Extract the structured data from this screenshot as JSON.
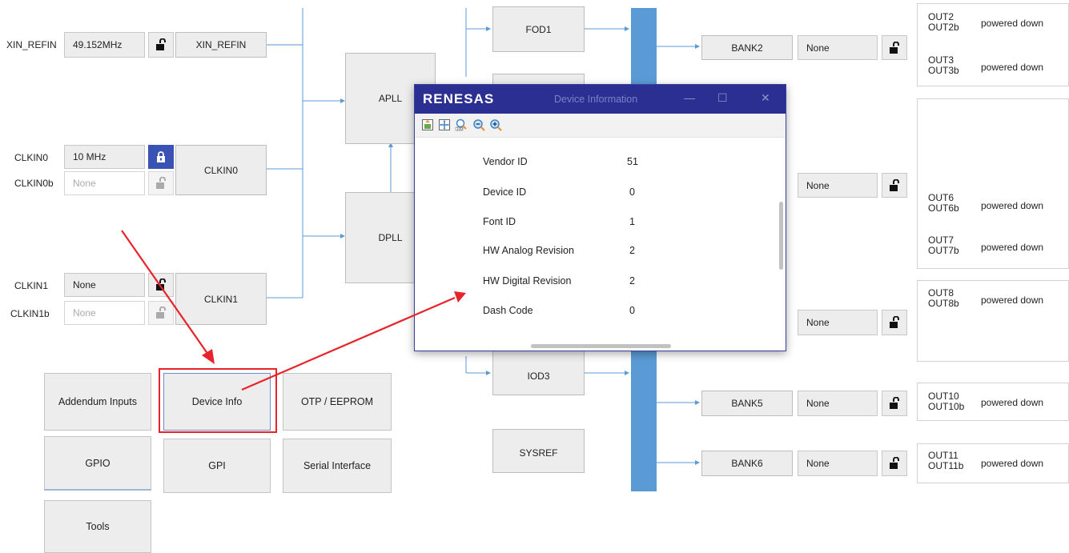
{
  "inputs": {
    "xin": {
      "label": "XIN_REFIN",
      "value": "49.152MHz",
      "block": "XIN_REFIN"
    },
    "clkin0": {
      "label": "CLKIN0",
      "value": "10 MHz",
      "block": "CLKIN0"
    },
    "clkin0b": {
      "label": "CLKIN0b",
      "value": "None"
    },
    "clkin1": {
      "label": "CLKIN1",
      "value": "None",
      "block": "CLKIN1"
    },
    "clkin1b": {
      "label": "CLKIN1b",
      "value": "None"
    }
  },
  "plls": {
    "apll": "APLL",
    "dpll": "DPLL"
  },
  "dividers": {
    "fod1": "FOD1",
    "iod3": "IOD3",
    "sysref": "SYSREF"
  },
  "banks": [
    {
      "name": "BANK2",
      "value": "None"
    },
    {
      "name": "",
      "value": "None"
    },
    {
      "name": "",
      "value": "None"
    },
    {
      "name": "BANK5",
      "value": "None"
    },
    {
      "name": "BANK6",
      "value": "None"
    }
  ],
  "outputs": [
    {
      "a": "OUT2",
      "b": "OUT2b",
      "status": "powered down"
    },
    {
      "a": "OUT3",
      "b": "OUT3b",
      "status": "powered down"
    },
    {
      "a": "OUT6",
      "b": "OUT6b",
      "status": "powered down"
    },
    {
      "a": "OUT7",
      "b": "OUT7b",
      "status": "powered down"
    },
    {
      "a": "OUT8",
      "b": "OUT8b",
      "status": "powered down"
    },
    {
      "a": "OUT10",
      "b": "OUT10b",
      "status": "powered down"
    },
    {
      "a": "OUT11",
      "b": "OUT11b",
      "status": "powered down"
    }
  ],
  "buttons": {
    "addendum": "Addendum Inputs",
    "device_info": "Device Info",
    "otp": "OTP / EEPROM",
    "gpio": "GPIO",
    "gpi": "GPI",
    "serial": "Serial Interface",
    "tools": "Tools"
  },
  "dialog": {
    "brand": "RENESAS",
    "title": "Device Information",
    "rows": [
      {
        "label": "Vendor ID",
        "value": "51"
      },
      {
        "label": "Device ID",
        "value": "0"
      },
      {
        "label": "Font ID",
        "value": "1"
      },
      {
        "label": "HW Analog Revision",
        "value": "2"
      },
      {
        "label": "HW Digital Revision",
        "value": "2"
      },
      {
        "label": "Dash Code",
        "value": "0"
      }
    ],
    "toolbar_icons": [
      "fit-page-icon",
      "fit-all-icon",
      "zoom-100-icon",
      "zoom-out-icon",
      "zoom-in-icon"
    ]
  },
  "colors": {
    "wire": "#5b9bd5",
    "bus": "#5b9bd5",
    "annotation": "#e8232a",
    "titlebar": "#2b2f92",
    "lock_active": "#3a52b4"
  }
}
